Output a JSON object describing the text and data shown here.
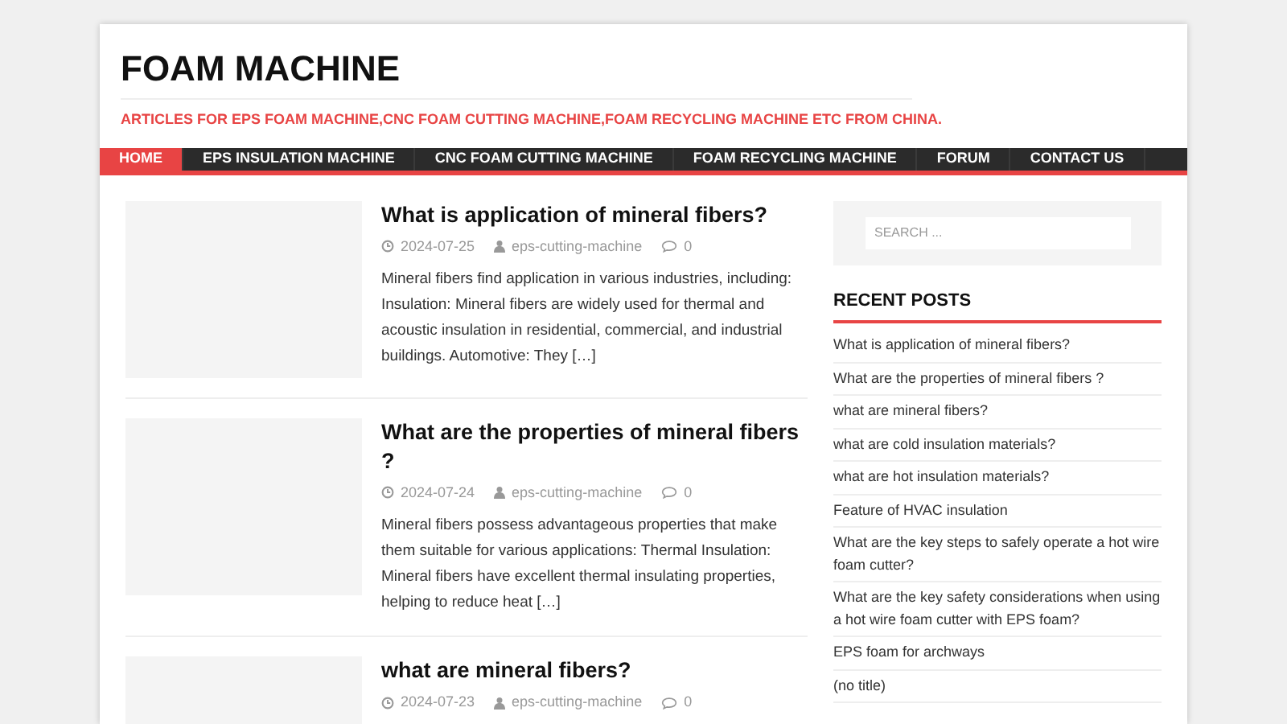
{
  "site": {
    "title": "FOAM MACHINE",
    "tagline": "ARTICLES FOR EPS FOAM MACHINE,CNC FOAM CUTTING MACHINE,FOAM RECYCLING MACHINE ETC FROM CHINA."
  },
  "nav": [
    {
      "label": "HOME",
      "selected": true
    },
    {
      "label": "EPS INSULATION MACHINE",
      "selected": false
    },
    {
      "label": "CNC FOAM CUTTING MACHINE",
      "selected": false
    },
    {
      "label": "FOAM RECYCLING MACHINE",
      "selected": false
    },
    {
      "label": "FORUM",
      "selected": false
    },
    {
      "label": "CONTACT US",
      "selected": false
    }
  ],
  "posts": [
    {
      "title": "What is application of mineral fibers?",
      "date": "2024-07-25",
      "author": "eps-cutting-machine",
      "comments": "0",
      "excerpt": "Mineral fibers find application in various industries, including: Insulation: Mineral fibers are widely used for thermal and acoustic insulation in residential, commercial, and industrial buildings. Automotive: They […]"
    },
    {
      "title": "What are the properties of mineral fibers ?",
      "date": "2024-07-24",
      "author": "eps-cutting-machine",
      "comments": "0",
      "excerpt": "Mineral fibers possess advantageous properties that make them suitable for various applications: Thermal Insulation: Mineral fibers have excellent thermal insulating properties, helping to reduce heat […]"
    },
    {
      "title": "what are mineral fibers?",
      "date": "2024-07-23",
      "author": "eps-cutting-machine",
      "comments": "0"
    }
  ],
  "sidebar": {
    "search": {
      "placeholder": "SEARCH ..."
    },
    "recent_posts": {
      "heading": "RECENT POSTS",
      "items": [
        "What is application of mineral fibers?",
        "What are the properties of mineral fibers ?",
        "what are mineral fibers?",
        "what are cold insulation materials?",
        "what are hot insulation materials?",
        "Feature of HVAC insulation",
        "What are the key steps to safely operate a hot wire foam cutter?",
        "What are the key safety considerations when using a hot wire foam cutter with EPS foam?",
        "EPS foam for archways",
        "(no title)"
      ]
    }
  }
}
